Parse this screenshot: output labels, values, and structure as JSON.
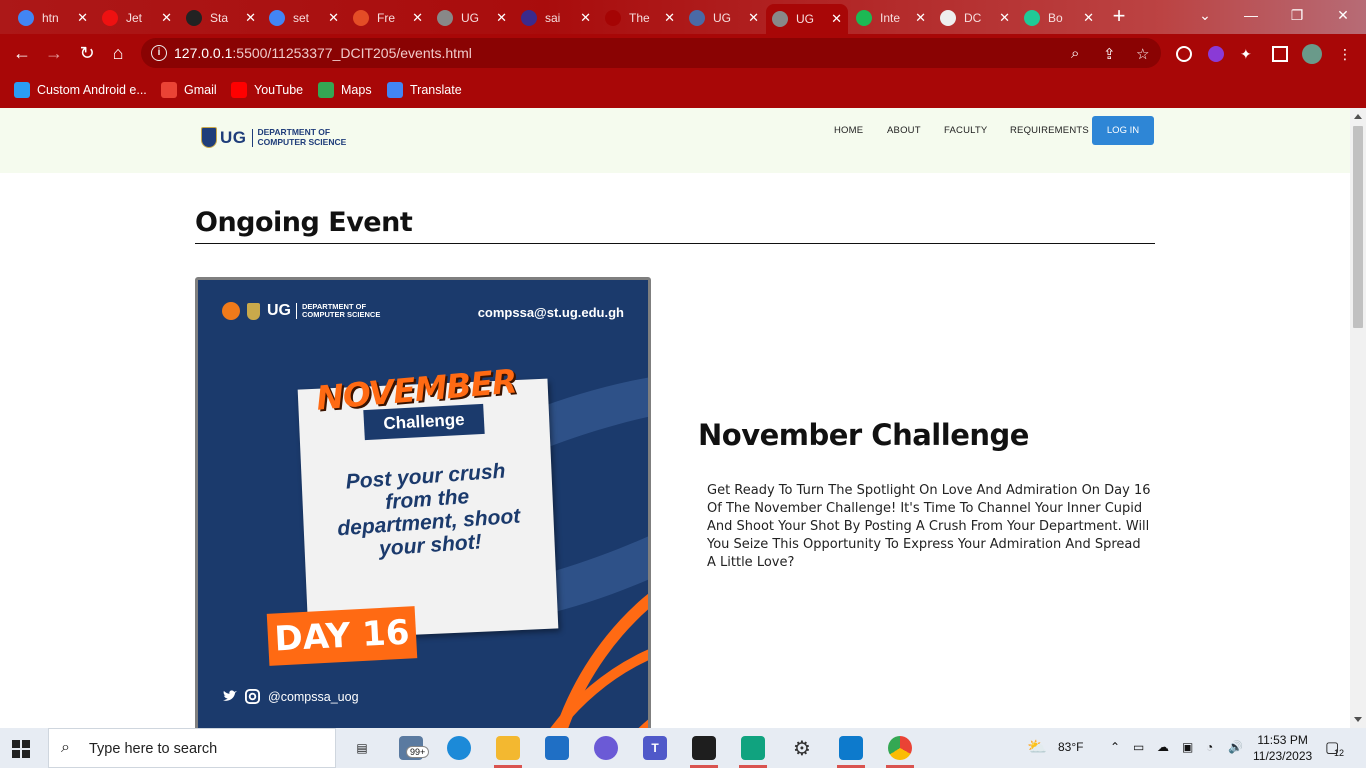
{
  "browser": {
    "tabs": [
      {
        "label": "htn",
        "icon": "google-icon",
        "color": "#4285f4"
      },
      {
        "label": "Jet",
        "icon": "jetbrains-icon",
        "color": "#e11"
      },
      {
        "label": "Sta",
        "icon": "github-icon",
        "color": "#222"
      },
      {
        "label": "set",
        "icon": "google-icon",
        "color": "#4285f4"
      },
      {
        "label": "Fre",
        "icon": "html5-icon",
        "color": "#e44d26"
      },
      {
        "label": "UG",
        "icon": "ug-icon",
        "color": "#888"
      },
      {
        "label": "sai",
        "icon": "crest-icon",
        "color": "#3b2a8c"
      },
      {
        "label": "The",
        "icon": "generic-icon",
        "color": "#a50404"
      },
      {
        "label": "UG",
        "icon": "ug-icon",
        "color": "#4a6aa6"
      },
      {
        "label": "UG",
        "icon": "ug-icon",
        "color": "#888"
      },
      {
        "label": "Inte",
        "icon": "play-icon",
        "color": "#1db954"
      },
      {
        "label": "DC",
        "icon": "circle-icon",
        "color": "#eee"
      },
      {
        "label": "Bo",
        "icon": "box-icon",
        "color": "#20c997"
      }
    ],
    "url_host": "127.0.0.1",
    "url_rest": ":5500/11253377_DCIT205/events.html",
    "bookmarks": [
      {
        "label": "Custom Android e...",
        "icon": "nox-icon",
        "color": "#2a9df4"
      },
      {
        "label": "Gmail",
        "icon": "gmail-icon",
        "color": "#ea4335"
      },
      {
        "label": "YouTube",
        "icon": "youtube-icon",
        "color": "#ff0000"
      },
      {
        "label": "Maps",
        "icon": "maps-icon",
        "color": "#34a853"
      },
      {
        "label": "Translate",
        "icon": "translate-icon",
        "color": "#4285f4"
      }
    ]
  },
  "site": {
    "logo_text": "UG",
    "logo_dept_line1": "DEPARTMENT OF",
    "logo_dept_line2": "COMPUTER SCIENCE",
    "nav": [
      "HOME",
      "ABOUT",
      "FACULTY",
      "REQUIREMENTS"
    ],
    "login_label": "LOG IN",
    "section_title": "Ongoing Event",
    "poster": {
      "logo_text": "UG",
      "dept_line1": "DEPARTMENT OF",
      "dept_line2": "COMPUTER SCIENCE",
      "email": "compssa@st.ug.edu.gh",
      "headline": "NOVEMBER",
      "tag": "Challenge",
      "message": "Post your crush from the department, shoot your shot!",
      "day": "DAY 16",
      "handle": "@compssa_uog"
    },
    "event_title": "November Challenge",
    "event_description": "Get Ready To Turn The Spotlight On Love And Admiration On Day 16 Of The November Challenge! It's Time To Channel Your Inner Cupid And Shoot Your Shot By Posting A Crush From Your Department. Will You Seize This Opportunity To Express Your Admiration And Spread A Little Love?"
  },
  "taskbar": {
    "search_placeholder": "Type here to search",
    "mail_badge": "99+",
    "weather": "83°F",
    "time": "11:53 PM",
    "date": "11/23/2023",
    "notifications": "12"
  }
}
